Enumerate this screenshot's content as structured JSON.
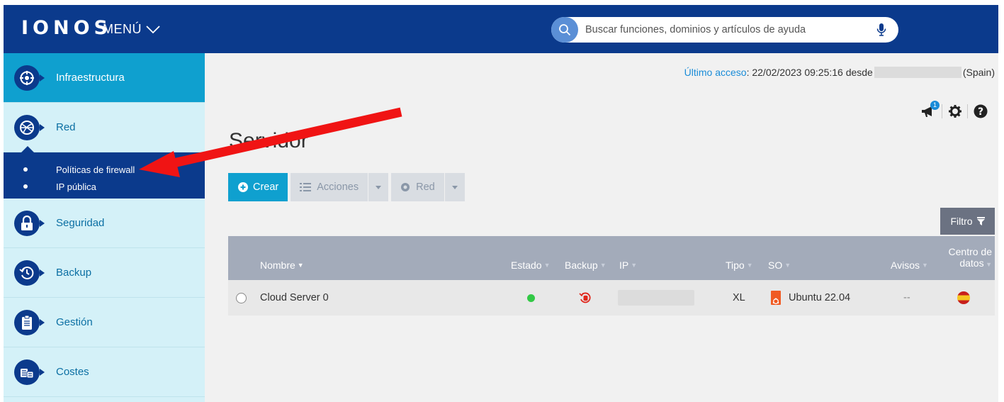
{
  "brand": {
    "logo": "IONOS",
    "menu_label": "MENÚ"
  },
  "search": {
    "placeholder": "Buscar funciones, dominios y artículos de ayuda"
  },
  "sidebar": {
    "items": [
      {
        "label": "Infraestructura",
        "icon": "network-hub-icon"
      },
      {
        "label": "Red",
        "icon": "globe-icon"
      },
      {
        "label": "Seguridad",
        "icon": "lock-icon"
      },
      {
        "label": "Backup",
        "icon": "clock-backup-icon"
      },
      {
        "label": "Gestión",
        "icon": "clipboard-icon"
      },
      {
        "label": "Costes",
        "icon": "coins-icon"
      }
    ],
    "subitems": [
      {
        "label": "Políticas de firewall"
      },
      {
        "label": "IP pública"
      }
    ]
  },
  "header_info": {
    "last_access_label": "Último acceso",
    "last_access_value": ": 22/02/2023 09:25:16 desde",
    "location": "(Spain)"
  },
  "notifications": {
    "count": "1"
  },
  "page": {
    "title": "Servidor"
  },
  "toolbar": {
    "create_label": "Crear",
    "actions_label": "Acciones",
    "network_label": "Red"
  },
  "filter": {
    "label": "Filtro"
  },
  "table": {
    "columns": {
      "name": "Nombre",
      "status": "Estado",
      "backup": "Backup",
      "ip": "IP",
      "type": "Tipo",
      "os": "SO",
      "alerts": "Avisos",
      "datacenter_line1": "Centro de",
      "datacenter_line2": "datos"
    },
    "rows": [
      {
        "name": "Cloud Server 0",
        "status": "running",
        "type": "XL",
        "os": "Ubuntu 22.04",
        "alerts": "--"
      }
    ]
  },
  "colors": {
    "header_bg": "#0b3a8c",
    "accent": "#0fa0cf",
    "sidebar_bg": "#d4f1f8",
    "arrow": "#f01414",
    "status_green": "#32c946"
  }
}
